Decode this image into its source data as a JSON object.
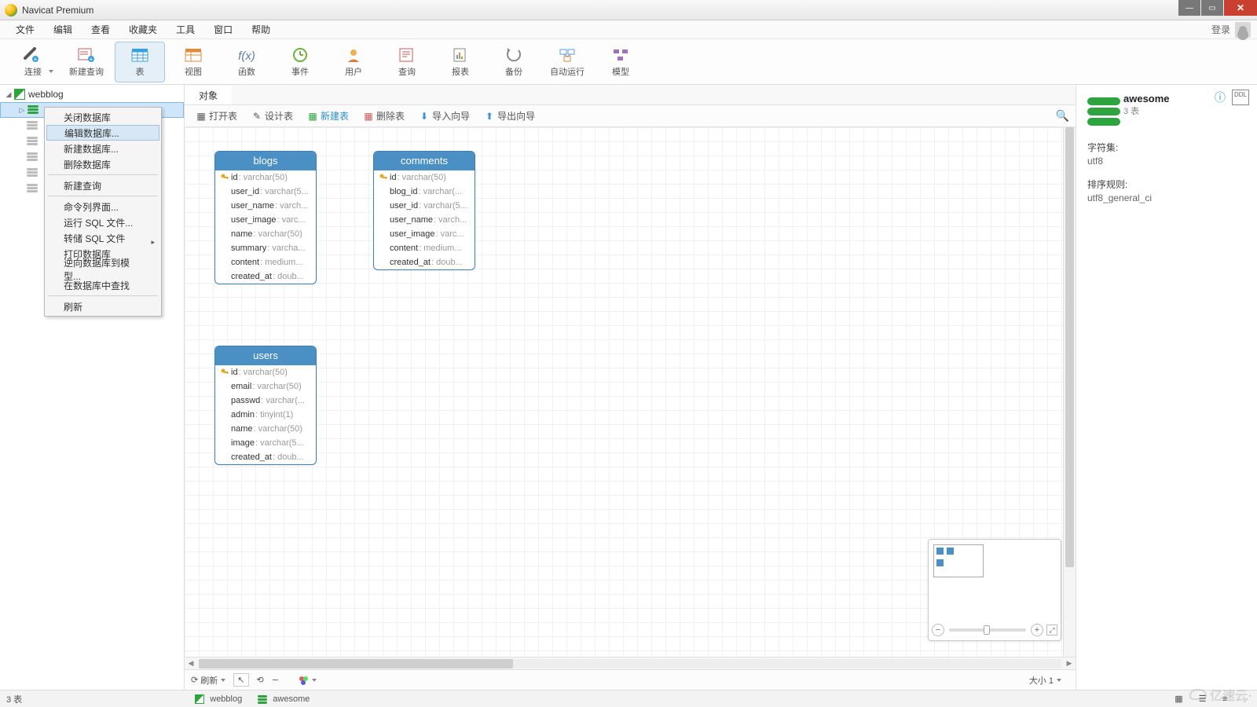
{
  "window": {
    "title": "Navicat Premium"
  },
  "menu": {
    "file": "文件",
    "edit": "编辑",
    "view": "查看",
    "favorites": "收藏夹",
    "tools": "工具",
    "window": "窗口",
    "help": "帮助",
    "login": "登录"
  },
  "toolbar": {
    "connect": "连接",
    "newquery": "新建查询",
    "table": "表",
    "view": "视图",
    "func": "函数",
    "event": "事件",
    "user": "用户",
    "query": "查询",
    "report": "报表",
    "backup": "备份",
    "autorun": "自动运行",
    "model": "模型"
  },
  "tree": {
    "connection": "webblog",
    "grey_db_count": 5
  },
  "context_menu": {
    "close_db": "关闭数据库",
    "edit_db": "编辑数据库...",
    "new_db": "新建数据库...",
    "delete_db": "删除数据库",
    "new_query": "新建查询",
    "cmdline": "命令列界面...",
    "run_sql": "运行 SQL 文件...",
    "dump_sql": "转储 SQL 文件",
    "print_db": "打印数据库",
    "reverse": "逆向数据库到模型...",
    "find_in_db": "在数据库中查找",
    "refresh": "刷新"
  },
  "tabs": {
    "objects": "对象"
  },
  "actions": {
    "open_table": "打开表",
    "design_table": "设计表",
    "new_table": "新建表",
    "delete_table": "删除表",
    "import": "导入向导",
    "export": "导出向导"
  },
  "diagram": {
    "blogs": {
      "title": "blogs",
      "cols": [
        {
          "k": true,
          "n": "id",
          "t": "varchar(50)"
        },
        {
          "k": false,
          "n": "user_id",
          "t": "varchar(5..."
        },
        {
          "k": false,
          "n": "user_name",
          "t": "varch..."
        },
        {
          "k": false,
          "n": "user_image",
          "t": "varc..."
        },
        {
          "k": false,
          "n": "name",
          "t": "varchar(50)"
        },
        {
          "k": false,
          "n": "summary",
          "t": "varcha..."
        },
        {
          "k": false,
          "n": "content",
          "t": "medium..."
        },
        {
          "k": false,
          "n": "created_at",
          "t": "doub..."
        }
      ]
    },
    "comments": {
      "title": "comments",
      "cols": [
        {
          "k": true,
          "n": "id",
          "t": "varchar(50)"
        },
        {
          "k": false,
          "n": "blog_id",
          "t": "varchar(..."
        },
        {
          "k": false,
          "n": "user_id",
          "t": "varchar(5..."
        },
        {
          "k": false,
          "n": "user_name",
          "t": "varch..."
        },
        {
          "k": false,
          "n": "user_image",
          "t": "varc..."
        },
        {
          "k": false,
          "n": "content",
          "t": "medium..."
        },
        {
          "k": false,
          "n": "created_at",
          "t": "doub..."
        }
      ]
    },
    "users": {
      "title": "users",
      "cols": [
        {
          "k": true,
          "n": "id",
          "t": "varchar(50)"
        },
        {
          "k": false,
          "n": "email",
          "t": "varchar(50)"
        },
        {
          "k": false,
          "n": "passwd",
          "t": "varchar(..."
        },
        {
          "k": false,
          "n": "admin",
          "t": "tinyint(1)"
        },
        {
          "k": false,
          "n": "name",
          "t": "varchar(50)"
        },
        {
          "k": false,
          "n": "image",
          "t": "varchar(5..."
        },
        {
          "k": false,
          "n": "created_at",
          "t": "doub..."
        }
      ]
    }
  },
  "refresh_bar": {
    "refresh": "刷新",
    "size": "大小 1"
  },
  "details": {
    "name": "awesome",
    "subtitle": "3 表",
    "charset_label": "字符集:",
    "charset_value": "utf8",
    "collation_label": "排序规则:",
    "collation_value": "utf8_general_ci"
  },
  "status": {
    "left": "3 表",
    "conn": "webblog",
    "db": "awesome"
  },
  "watermark": "亿速云"
}
